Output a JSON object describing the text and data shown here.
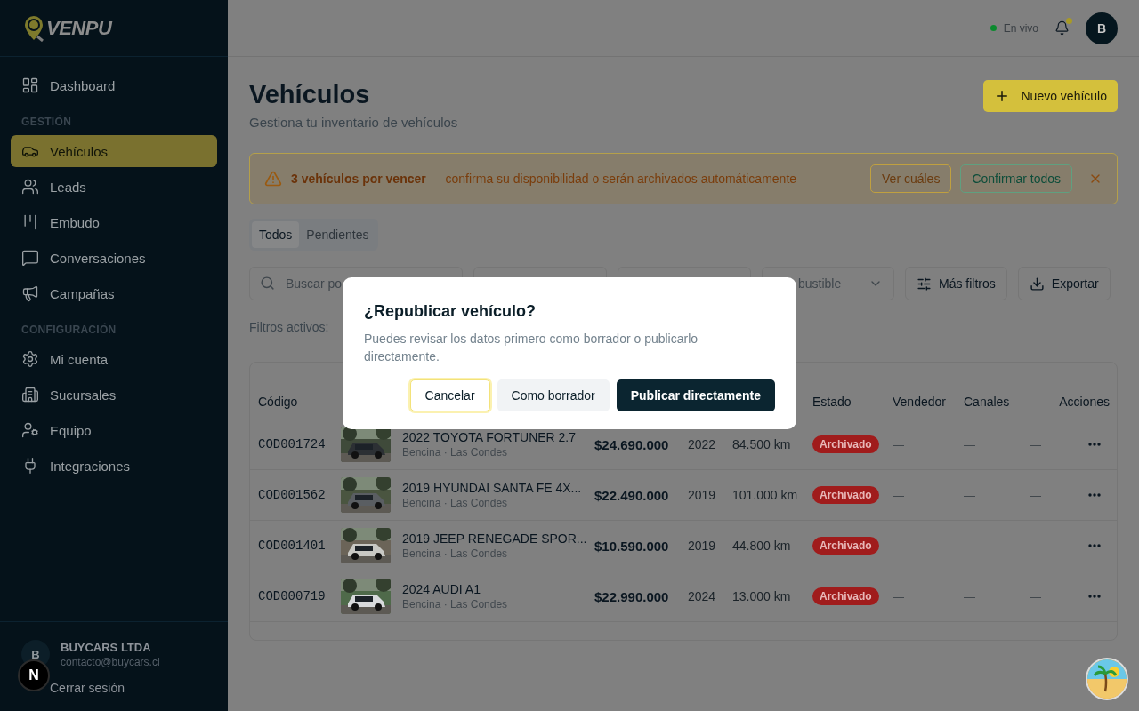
{
  "sidebar": {
    "logo": "VENPU",
    "sections": [
      {
        "items": [
          {
            "label": "Dashboard",
            "selected": false
          }
        ]
      },
      {
        "heading": "GESTIÓN",
        "items": [
          {
            "label": "Vehículos",
            "selected": true
          },
          {
            "label": "Leads",
            "selected": false
          },
          {
            "label": "Embudo",
            "selected": false
          },
          {
            "label": "Conversaciones",
            "selected": false
          },
          {
            "label": "Campañas",
            "selected": false
          }
        ]
      },
      {
        "heading": "CONFIGURACIÓN",
        "items": [
          {
            "label": "Mi cuenta",
            "selected": false
          },
          {
            "label": "Sucursales",
            "selected": false
          },
          {
            "label": "Equipo",
            "selected": false
          },
          {
            "label": "Integraciones",
            "selected": false
          }
        ]
      }
    ],
    "account": {
      "initial": "B",
      "name": "BUYCARS LTDA",
      "email": "contacto@buycars.cl"
    },
    "logout": "Cerrar sesión",
    "dev_badge": "N"
  },
  "topbar": {
    "status": "En vivo",
    "notification": true,
    "avatar": "B"
  },
  "page": {
    "title": "Vehículos",
    "subtitle": "Gestiona tu inventario de vehículos",
    "new_button": "Nuevo vehículo"
  },
  "alert": {
    "text": "**3 vehículos por vencer** — confirma su disponibilidad o serán archivados automáticamente",
    "buttons": [
      "Ver cuáles",
      "Confirmar todos"
    ]
  },
  "tabs": [
    {
      "label": "Todos",
      "selected": true
    },
    {
      "label": "Pendientes",
      "selected": false
    }
  ],
  "filters": {
    "search_placeholder": "Buscar po",
    "fuel_select": "bustible",
    "more_filters": "Más filtros",
    "export": "Exportar",
    "active_label": "Filtros activos:"
  },
  "table": {
    "columns": [
      "Código",
      "",
      "",
      "",
      "",
      "",
      "Estado",
      "Vendedor",
      "Canales",
      "",
      "Acciones"
    ],
    "rows": [
      {
        "code": "COD001724",
        "title": "2022 TOYOTA FORTUNER 2.7",
        "subtitle": "Bencina · Las Condes",
        "price": "$24.690.000",
        "year": "2022",
        "km": "84.500 km",
        "status": "Archivado",
        "seller": "—",
        "channels": "—",
        "column_10": "—"
      },
      {
        "code": "COD001562",
        "title": "2019 HYUNDAI SANTA FE 4X...",
        "subtitle": "Bencina · Las Condes",
        "price": "$22.490.000",
        "year": "2019",
        "km": "101.000 km",
        "status": "Archivado",
        "seller": "—",
        "channels": "—",
        "column_10": "—"
      },
      {
        "code": "COD001401",
        "title": "2019 JEEP RENEGADE SPOR...",
        "subtitle": "Bencina · Las Condes",
        "price": "$10.590.000",
        "year": "2019",
        "km": "44.800 km",
        "status": "Archivado",
        "seller": "—",
        "channels": "—",
        "column_10": "—"
      },
      {
        "code": "COD000719",
        "title": "2024 AUDI A1",
        "subtitle": "Bencina · Las Condes",
        "price": "$22.990.000",
        "year": "2024",
        "km": "13.000 km",
        "status": "Archivado",
        "seller": "—",
        "channels": "—",
        "column_10": "—"
      }
    ]
  },
  "dialog": {
    "title": "¿Republicar vehículo?",
    "text": "Puedes revisar los datos primero como borrador o publicarlo directamente.",
    "buttons": [
      {
        "label": "Cancelar",
        "kind": "focused"
      },
      {
        "label": "Como borrador",
        "kind": "secondary"
      },
      {
        "label": "Publicar directamente",
        "kind": "primary"
      }
    ]
  }
}
